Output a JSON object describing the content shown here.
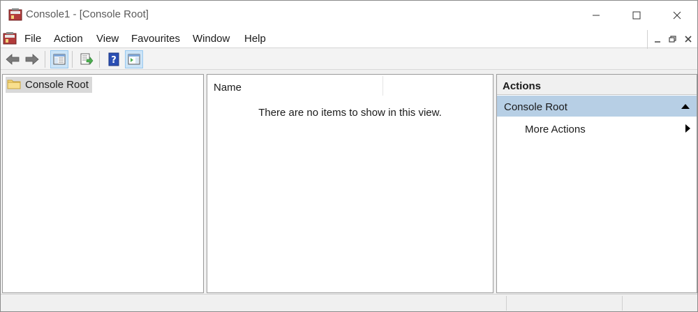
{
  "window": {
    "title": "Console1 - [Console Root]"
  },
  "menubar": {
    "items": [
      "File",
      "Action",
      "View",
      "Favourites",
      "Window",
      "Help"
    ]
  },
  "toolbar": {
    "buttons": [
      {
        "icon": "back-arrow-icon",
        "active": false
      },
      {
        "icon": "forward-arrow-icon",
        "active": false
      },
      {
        "icon": "show-hide-console-tree-icon",
        "active": true
      },
      {
        "icon": "export-list-icon",
        "active": false
      },
      {
        "icon": "help-icon",
        "active": false
      },
      {
        "icon": "show-hide-action-pane-icon",
        "active": true
      }
    ]
  },
  "tree": {
    "root_label": "Console Root"
  },
  "list": {
    "column_name": "Name",
    "empty_message": "There are no items to show in this view."
  },
  "actions": {
    "header": "Actions",
    "group_label": "Console Root",
    "item_label": "More Actions"
  },
  "colors": {
    "accent_selected": "#cce4f7",
    "actions_group_bg": "#b7cfe5",
    "tree_selected_bg": "#d9d9d9"
  }
}
